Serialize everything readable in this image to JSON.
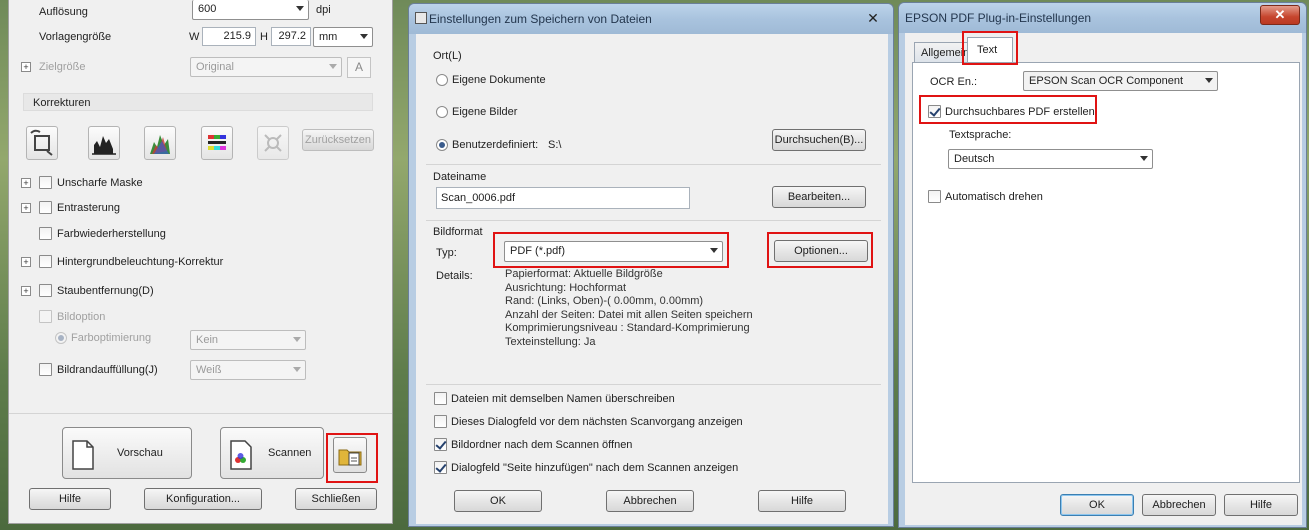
{
  "left": {
    "aufloesung_label": "Auflösung",
    "aufloesung_value": "600",
    "dpi_label": "dpi",
    "vorlagengroesse_label": "Vorlagengröße",
    "w_label": "W",
    "w_value": "215.9",
    "h_label": "H",
    "h_value": "297.2",
    "unit_value": "mm",
    "zielgroesse_label": "Zielgröße",
    "zielgroesse_value": "Original",
    "korrekturen_label": "Korrekturen",
    "zuruecksetzen": "Zurücksetzen",
    "options": [
      {
        "label": "Unscharfe Maske"
      },
      {
        "label": "Entrasterung"
      },
      {
        "label": "Farbwiederherstellung"
      },
      {
        "label": "Hintergrundbeleuchtung-Korrektur"
      },
      {
        "label": "Staubentfernung(D)"
      }
    ],
    "bildoption_label": "Bildoption",
    "farboptimierung_label": "Farboptimierung",
    "farboptimierung_value": "Kein",
    "bildrand_label": "Bildrandauffüllung(J)",
    "bildrand_value": "Weiß",
    "vorschau": "Vorschau",
    "scannen": "Scannen",
    "hilfe": "Hilfe",
    "konfiguration": "Konfiguration...",
    "schliessen": "Schließen"
  },
  "middle": {
    "title": "Einstellungen zum Speichern von Dateien",
    "close": "✕",
    "ort_label": "Ort(L)",
    "eigene_dokumente": "Eigene Dokumente",
    "eigene_bilder": "Eigene Bilder",
    "benutzerdefiniert": "Benutzerdefiniert:",
    "path": "S:\\",
    "durchsuchen": "Durchsuchen(B)...",
    "dateiname_label": "Dateiname",
    "dateiname_value": "Scan_0006.pdf",
    "bearbeiten": "Bearbeiten...",
    "bildformat_label": "Bildformat",
    "typ_label": "Typ:",
    "typ_value": "PDF (*.pdf)",
    "optionen": "Optionen...",
    "details_label": "Details:",
    "details": [
      "Papierformat: Aktuelle Bildgröße",
      "Ausrichtung: Hochformat",
      "Rand: (Links, Oben)-( 0.00mm, 0.00mm)",
      "Anzahl der Seiten: Datei mit allen Seiten speichern",
      "Komprimierungsniveau : Standard-Komprimierung",
      "Texteinstellung: Ja"
    ],
    "checks": [
      {
        "label": "Dateien mit demselben Namen überschreiben"
      },
      {
        "label": "Dieses Dialogfeld vor dem nächsten Scanvorgang anzeigen"
      },
      {
        "label": "Bildordner nach dem Scannen öffnen"
      },
      {
        "label": "Dialogfeld \"Seite hinzufügen\" nach dem Scannen anzeigen"
      }
    ],
    "ok": "OK",
    "abbrechen": "Abbrechen",
    "hilfe": "Hilfe"
  },
  "right": {
    "title": "EPSON PDF Plug-in-Einstellungen",
    "close": "✕",
    "tab_allgemein": "Allgemein",
    "tab_text": "Text",
    "ocr_label": "OCR En.:",
    "ocr_value": "EPSON Scan OCR Component",
    "durchsuchbar": "Durchsuchbares PDF erstellen",
    "textsprache_label": "Textsprache:",
    "textsprache_value": "Deutsch",
    "automatisch": "Automatisch drehen",
    "ok": "OK",
    "abbrechen": "Abbrechen",
    "hilfe": "Hilfe"
  },
  "colors": {
    "highlight": "#e01313",
    "title_bar": "#a9c3de"
  }
}
